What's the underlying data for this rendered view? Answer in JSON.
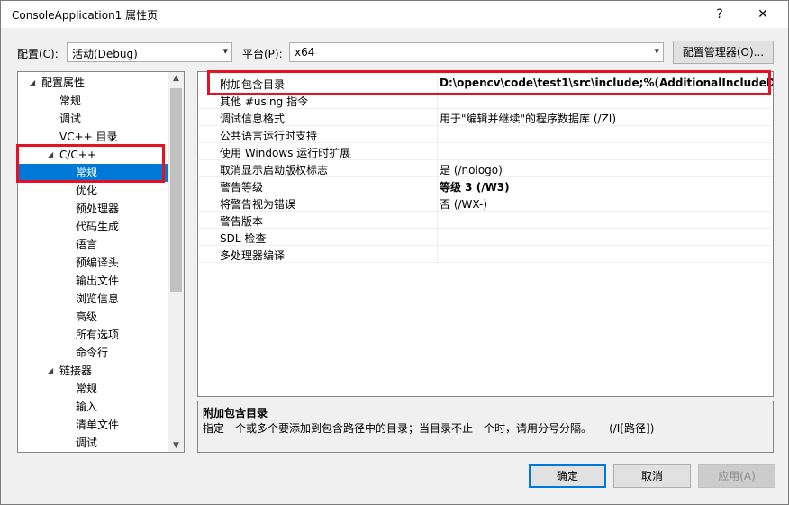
{
  "window": {
    "title": "ConsoleApplication1 属性页",
    "help": "?",
    "close": "✕"
  },
  "top_bar": {
    "config_label": "配置(C):",
    "config_value": "活动(Debug)",
    "platform_label": "平台(P):",
    "platform_value": "x64",
    "config_manager": "配置管理器(O)..."
  },
  "tree": [
    {
      "label": "配置属性",
      "level": 0,
      "expander": "expanded"
    },
    {
      "label": "常规",
      "level": 1
    },
    {
      "label": "调试",
      "level": 1
    },
    {
      "label": "VC++ 目录",
      "level": 1
    },
    {
      "label": "C/C++",
      "level": 1,
      "expander": "expanded"
    },
    {
      "label": "常规",
      "level": 2,
      "selected": true
    },
    {
      "label": "优化",
      "level": 2
    },
    {
      "label": "预处理器",
      "level": 2
    },
    {
      "label": "代码生成",
      "level": 2
    },
    {
      "label": "语言",
      "level": 2
    },
    {
      "label": "预编译头",
      "level": 2
    },
    {
      "label": "输出文件",
      "level": 2
    },
    {
      "label": "浏览信息",
      "level": 2
    },
    {
      "label": "高级",
      "level": 2
    },
    {
      "label": "所有选项",
      "level": 2
    },
    {
      "label": "命令行",
      "level": 2
    },
    {
      "label": "链接器",
      "level": 1,
      "expander": "expanded"
    },
    {
      "label": "常规",
      "level": 2
    },
    {
      "label": "输入",
      "level": 2
    },
    {
      "label": "清单文件",
      "level": 2
    },
    {
      "label": "调试",
      "level": 2
    }
  ],
  "properties": [
    {
      "name": "附加包含目录",
      "value": "D:\\opencv\\code\\test1\\src\\include;%(AdditionalIncludeDire",
      "bold": true
    },
    {
      "name": "其他 #using 指令",
      "value": ""
    },
    {
      "name": "调试信息格式",
      "value": "用于\"编辑并继续\"的程序数据库 (/ZI)"
    },
    {
      "name": "公共语言运行时支持",
      "value": ""
    },
    {
      "name": "使用 Windows 运行时扩展",
      "value": ""
    },
    {
      "name": "取消显示启动版权标志",
      "value": "是 (/nologo)"
    },
    {
      "name": "警告等级",
      "value": "等级 3 (/W3)",
      "bold": true
    },
    {
      "name": "将警告视为错误",
      "value": "否 (/WX-)"
    },
    {
      "name": "警告版本",
      "value": ""
    },
    {
      "name": "SDL 检查",
      "value": ""
    },
    {
      "name": "多处理器编译",
      "value": ""
    }
  ],
  "description": {
    "title": "附加包含目录",
    "text": "指定一个或多个要添加到包含路径中的目录；当目录不止一个时，请用分号分隔。     (/I[路径])"
  },
  "buttons": {
    "ok": "确定",
    "cancel": "取消",
    "apply": "应用(A)"
  },
  "colors": {
    "selection": "#0078d7",
    "highlight_box": "#e81123"
  }
}
